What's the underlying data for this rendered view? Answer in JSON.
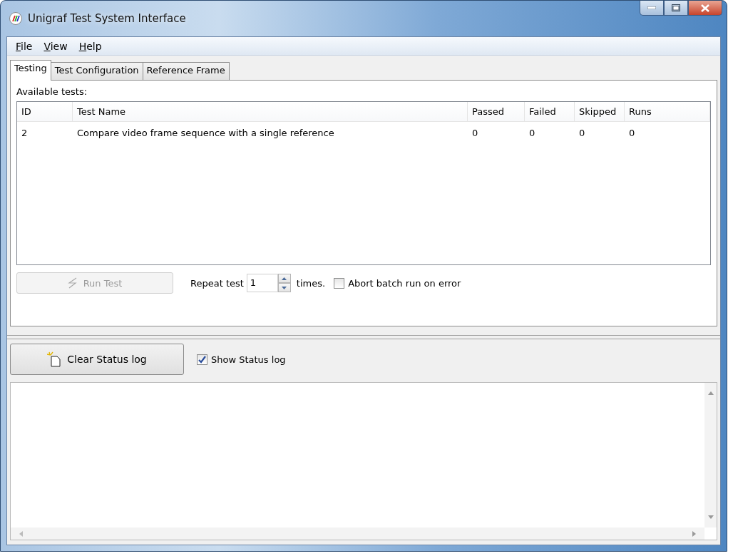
{
  "window": {
    "title": "Unigraf Test System Interface"
  },
  "menu": [
    {
      "label": "File"
    },
    {
      "label": "View"
    },
    {
      "label": "Help"
    }
  ],
  "tabs": [
    {
      "label": "Testing",
      "selected": true
    },
    {
      "label": "Test Configuration",
      "selected": false
    },
    {
      "label": "Reference Frame",
      "selected": false
    }
  ],
  "tests_label": "Available tests:",
  "table": {
    "columns": [
      "ID",
      "Test Name",
      "Passed",
      "Failed",
      "Skipped",
      "Runs"
    ],
    "rows": [
      [
        "2",
        "Compare video frame sequence with a single reference",
        "0",
        "0",
        "0",
        "0"
      ]
    ]
  },
  "run_button": {
    "label": "Run Test",
    "disabled": true
  },
  "repeat": {
    "label": "Repeat test",
    "value": "1",
    "suffix": "times."
  },
  "abort_checkbox": {
    "label": "Abort batch run on error",
    "checked": false
  },
  "clear_button": {
    "label": "Clear Status log",
    "disabled": false
  },
  "show_log_checkbox": {
    "label": "Show Status log",
    "checked": true
  }
}
